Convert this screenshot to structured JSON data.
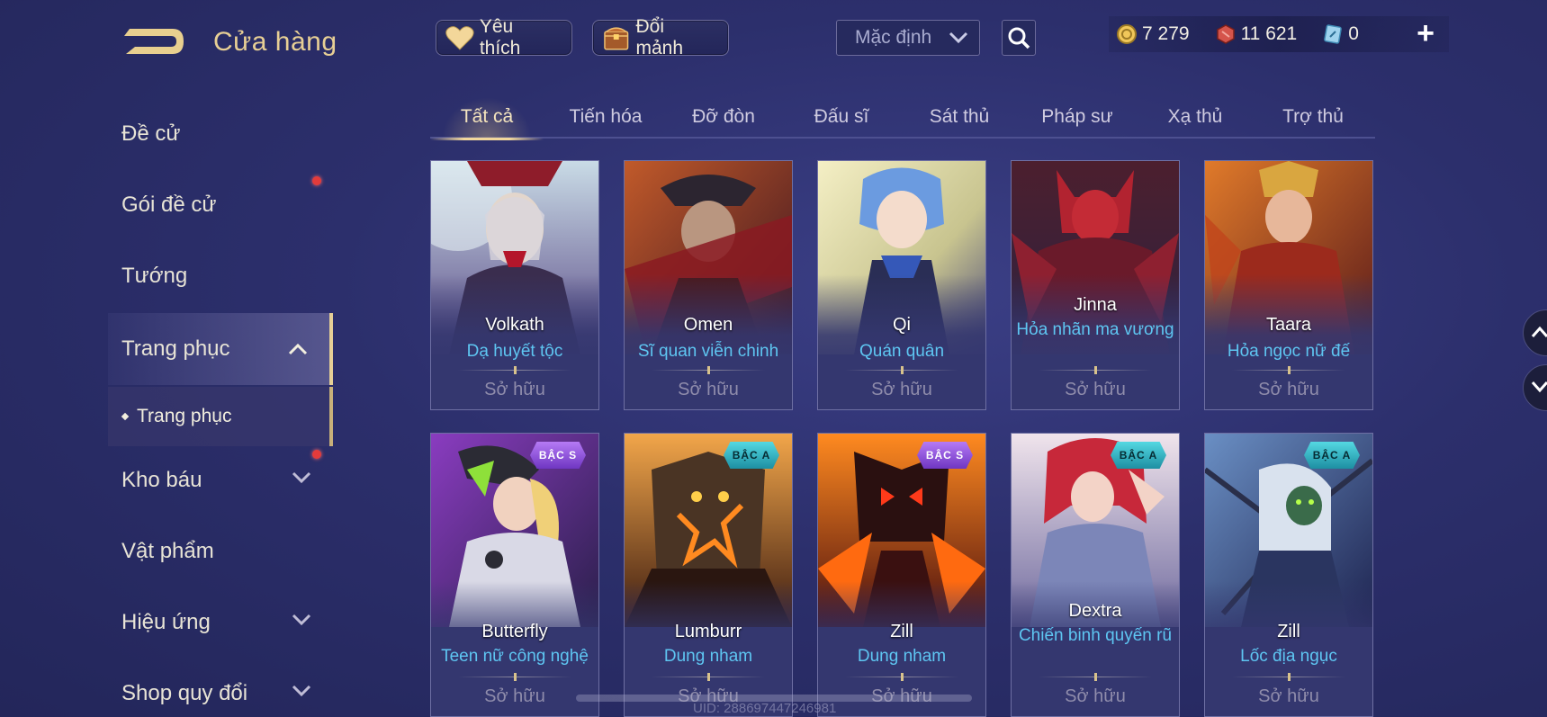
{
  "header": {
    "title": "Cửa hàng",
    "favorite_label": "Yêu thích",
    "exchange_label": "Đổi mảnh",
    "sort_value": "Mặc định",
    "currencies": [
      {
        "icon": "gold-coin-icon",
        "value": "7 279"
      },
      {
        "icon": "red-voucher-icon",
        "value": "11 621"
      },
      {
        "icon": "blue-token-icon",
        "value": "0"
      }
    ],
    "plus_label": "+"
  },
  "sidebar": {
    "items": [
      {
        "label": "Đề cử"
      },
      {
        "label": "Gói đề cử"
      },
      {
        "label": "Tướng"
      },
      {
        "label": "Trang phục"
      },
      {
        "label": "Kho báu"
      },
      {
        "label": "Vật phẩm"
      },
      {
        "label": "Hiệu ứng"
      },
      {
        "label": "Shop quy đổi"
      }
    ],
    "sub_item": "Trang phục"
  },
  "tabs": [
    "Tất cả",
    "Tiến hóa",
    "Đỡ đòn",
    "Đấu sĩ",
    "Sát thủ",
    "Pháp sư",
    "Xạ thủ",
    "Trợ thủ"
  ],
  "active_tab": "Tất cả",
  "skins": [
    {
      "hero": "Volkath",
      "skin": "Dạ huyết tộc",
      "status": "Sở hữu",
      "tier": ""
    },
    {
      "hero": "Omen",
      "skin": "Sĩ quan viễn chinh",
      "status": "Sở hữu",
      "tier": ""
    },
    {
      "hero": "Qi",
      "skin": "Quán quân",
      "status": "Sở hữu",
      "tier": ""
    },
    {
      "hero": "Jinna",
      "skin": "Hỏa nhãn ma vương",
      "status": "Sở hữu",
      "tier": ""
    },
    {
      "hero": "Taara",
      "skin": "Hỏa ngọc nữ đế",
      "status": "Sở hữu",
      "tier": ""
    },
    {
      "hero": "Butterfly",
      "skin": "Teen nữ công nghệ",
      "status": "Sở hữu",
      "tier": "BẬC S"
    },
    {
      "hero": "Lumburr",
      "skin": "Dung nham",
      "status": "Sở hữu",
      "tier": "BẬC A"
    },
    {
      "hero": "Zill",
      "skin": "Dung nham",
      "status": "Sở hữu",
      "tier": "BẬC S"
    },
    {
      "hero": "Dextra",
      "skin": "Chiến binh quyến rũ",
      "status": "Sở hữu",
      "tier": "BẬC A"
    },
    {
      "hero": "Zill",
      "skin": "Lốc địa ngục",
      "status": "Sở hữu",
      "tier": "BẬC A"
    }
  ],
  "footer": {
    "uid": "UID: 288697447246981"
  },
  "colors": {
    "accent_gold": "#e7cf95",
    "skin_name_blue": "#5ec6f2",
    "tier_s": "#8a4fe0",
    "tier_a": "#2fb6c6"
  }
}
